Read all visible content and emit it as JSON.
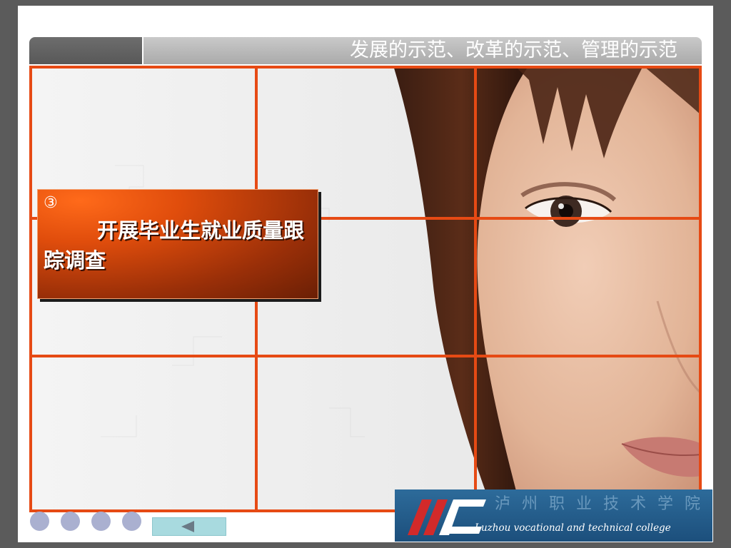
{
  "header": {
    "title": "发展的示范、改革的示范、管理的示范"
  },
  "callout": {
    "marker": "③",
    "text": "开展毕业生就业质量跟踪调查"
  },
  "nav": {
    "dots": [
      "",
      "",
      "",
      ""
    ],
    "back_icon": "left-triangle-icon"
  },
  "logo": {
    "name_cn": "泸州职业技术学院",
    "name_en": "Luzhou vocational and technical college"
  },
  "colors": {
    "grid": "#e64a14",
    "header": "#b0b0b0",
    "callout": "#c8470c",
    "nav_dot": "#aab0d0",
    "back_button": "#a8dadf"
  }
}
